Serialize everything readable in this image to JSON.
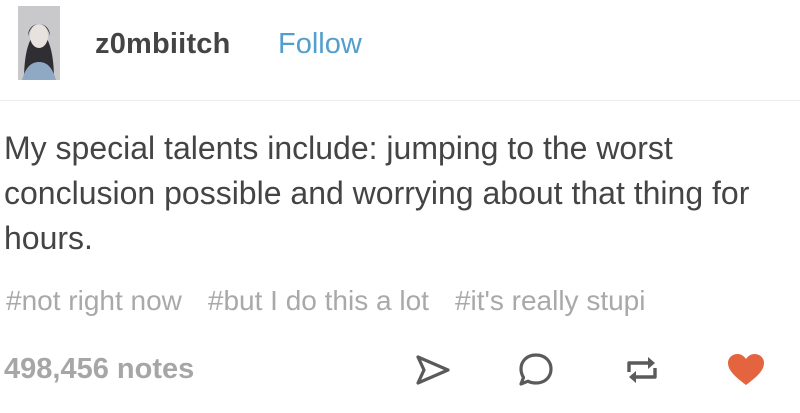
{
  "post": {
    "username": "z0mbiitch",
    "follow_label": "Follow",
    "body": "My special talents include: jumping to the worst conclusion possible and worrying about that thing for hours.",
    "tags": [
      "#not right now",
      "#but I do this a lot",
      "#it's really stupi"
    ],
    "notes": "498,456 notes"
  },
  "colors": {
    "follow": "#529ecc",
    "text": "#444444",
    "muted": "#a9a9a9",
    "like": "#e3643f"
  },
  "icons": {
    "share": "share-icon",
    "reply": "reply-icon",
    "reblog": "reblog-icon",
    "like": "heart-icon"
  }
}
